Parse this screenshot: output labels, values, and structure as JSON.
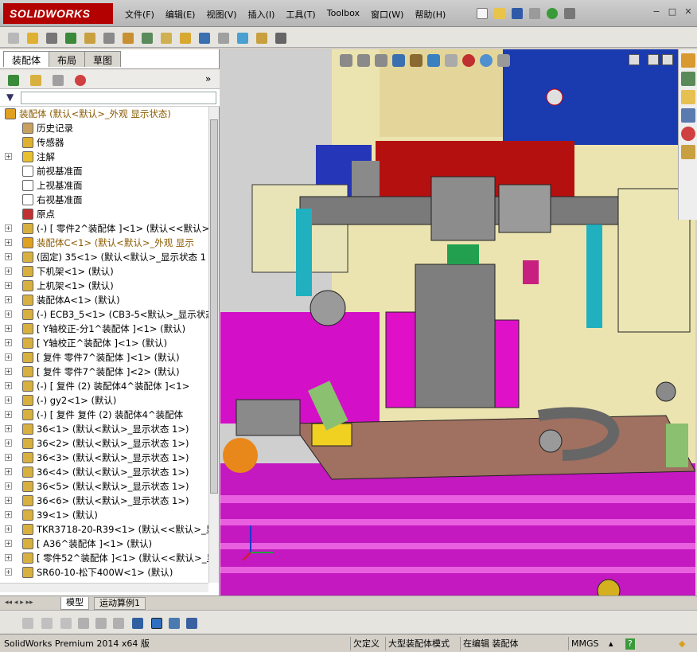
{
  "app": {
    "logo_text": "SOLIDWORKS",
    "brand_color": "#b30000"
  },
  "menu": [
    "文件(F)",
    "编辑(E)",
    "视图(V)",
    "插入(I)",
    "工具(T)",
    "Toolbox",
    "窗口(W)",
    "帮助(H)"
  ],
  "window_controls": [
    "−",
    "□",
    "✕"
  ],
  "panel_tabs": [
    "装配体",
    "布局",
    "草图"
  ],
  "feature_tree": [
    {
      "text": "装配体  (默认<默认>_外观 显示状态)",
      "icon": "assembly-warning-icon",
      "color": "#8a5a00",
      "indent": 0,
      "expand": ""
    },
    {
      "text": "历史记录",
      "icon": "history-icon",
      "color": "#000",
      "indent": 1,
      "expand": ""
    },
    {
      "text": "传感器",
      "icon": "sensor-icon",
      "color": "#000",
      "indent": 1,
      "expand": ""
    },
    {
      "text": "注解",
      "icon": "annotation-icon",
      "color": "#000",
      "indent": 1,
      "expand": "+"
    },
    {
      "text": "前视基准面",
      "icon": "plane-icon",
      "color": "#000",
      "indent": 1,
      "expand": ""
    },
    {
      "text": "上视基准面",
      "icon": "plane-icon",
      "color": "#000",
      "indent": 1,
      "expand": ""
    },
    {
      "text": "右视基准面",
      "icon": "plane-icon",
      "color": "#000",
      "indent": 1,
      "expand": ""
    },
    {
      "text": "原点",
      "icon": "origin-icon",
      "color": "#000",
      "indent": 1,
      "expand": ""
    },
    {
      "text": "(-) [ 零件2^装配体 ]<1> (默认<<默认>",
      "icon": "subassembly-icon",
      "color": "#000",
      "indent": 1,
      "expand": "+"
    },
    {
      "text": "装配体C<1> (默认<默认>_外观 显示",
      "icon": "assembly-warning-icon",
      "color": "#8a5a00",
      "indent": 1,
      "expand": "+"
    },
    {
      "text": "(固定) 35<1> (默认<默认>_显示状态 1",
      "icon": "subassembly-icon",
      "color": "#000",
      "indent": 1,
      "expand": "+"
    },
    {
      "text": "下机架<1> (默认)",
      "icon": "subassembly-icon",
      "color": "#000",
      "indent": 1,
      "expand": "+"
    },
    {
      "text": "上机架<1> (默认)",
      "icon": "subassembly-icon",
      "color": "#000",
      "indent": 1,
      "expand": "+"
    },
    {
      "text": "装配体A<1> (默认)",
      "icon": "subassembly-icon",
      "color": "#000",
      "indent": 1,
      "expand": "+"
    },
    {
      "text": "(-) ECB3_5<1> (CB3-5<默认>_显示状态",
      "icon": "subassembly-icon",
      "color": "#000",
      "indent": 1,
      "expand": "+"
    },
    {
      "text": "[ Y轴校正-分1^装配体 ]<1> (默认)",
      "icon": "subassembly-icon",
      "color": "#000",
      "indent": 1,
      "expand": "+"
    },
    {
      "text": "[ Y轴校正^装配体 ]<1> (默认)",
      "icon": "subassembly-icon",
      "color": "#000",
      "indent": 1,
      "expand": "+"
    },
    {
      "text": "[ 复件 零件7^装配体 ]<1> (默认)",
      "icon": "subassembly-icon",
      "color": "#000",
      "indent": 1,
      "expand": "+"
    },
    {
      "text": "[ 复件 零件7^装配体 ]<2> (默认)",
      "icon": "subassembly-icon",
      "color": "#000",
      "indent": 1,
      "expand": "+"
    },
    {
      "text": "(-) [ 复件 (2) 装配体4^装配体 ]<1>",
      "icon": "subassembly-icon",
      "color": "#000",
      "indent": 1,
      "expand": "+"
    },
    {
      "text": "(-) gy2<1> (默认)",
      "icon": "subassembly-icon",
      "color": "#000",
      "indent": 1,
      "expand": "+"
    },
    {
      "text": "(-) [ 复件 复件 (2) 装配体4^装配体",
      "icon": "subassembly-icon",
      "color": "#000",
      "indent": 1,
      "expand": "+"
    },
    {
      "text": "36<1> (默认<默认>_显示状态 1>)",
      "icon": "subassembly-icon",
      "color": "#000",
      "indent": 1,
      "expand": "+"
    },
    {
      "text": "36<2> (默认<默认>_显示状态 1>)",
      "icon": "subassembly-icon",
      "color": "#000",
      "indent": 1,
      "expand": "+"
    },
    {
      "text": "36<3> (默认<默认>_显示状态 1>)",
      "icon": "subassembly-icon",
      "color": "#000",
      "indent": 1,
      "expand": "+"
    },
    {
      "text": "36<4> (默认<默认>_显示状态 1>)",
      "icon": "subassembly-icon",
      "color": "#000",
      "indent": 1,
      "expand": "+"
    },
    {
      "text": "36<5> (默认<默认>_显示状态 1>)",
      "icon": "subassembly-icon",
      "color": "#000",
      "indent": 1,
      "expand": "+"
    },
    {
      "text": "36<6> (默认<默认>_显示状态 1>)",
      "icon": "subassembly-icon",
      "color": "#000",
      "indent": 1,
      "expand": "+"
    },
    {
      "text": "39<1> (默认)",
      "icon": "subassembly-icon",
      "color": "#000",
      "indent": 1,
      "expand": "+"
    },
    {
      "text": "TKR3718-20-R39<1> (默认<<默认>_显示状",
      "icon": "subassembly-icon",
      "color": "#000",
      "indent": 1,
      "expand": "+"
    },
    {
      "text": "[ A36^装配体 ]<1> (默认)",
      "icon": "subassembly-icon",
      "color": "#000",
      "indent": 1,
      "expand": "+"
    },
    {
      "text": "[ 零件52^装配体 ]<1> (默认<<默认>_显",
      "icon": "subassembly-icon",
      "color": "#000",
      "indent": 1,
      "expand": "+"
    },
    {
      "text": "SR60-10-松下400W<1> (默认)",
      "icon": "subassembly-icon",
      "color": "#000",
      "indent": 1,
      "expand": "+"
    }
  ],
  "bottom_tabs": [
    "模型",
    "运动算例1"
  ],
  "status": {
    "product": "SolidWorks Premium 2014 x64 版",
    "undefined": "欠定义",
    "large_mode": "大型装配体模式",
    "editing": "在编辑 装配体",
    "units": "MMGS",
    "units_arrow": "▴",
    "help": "?"
  }
}
